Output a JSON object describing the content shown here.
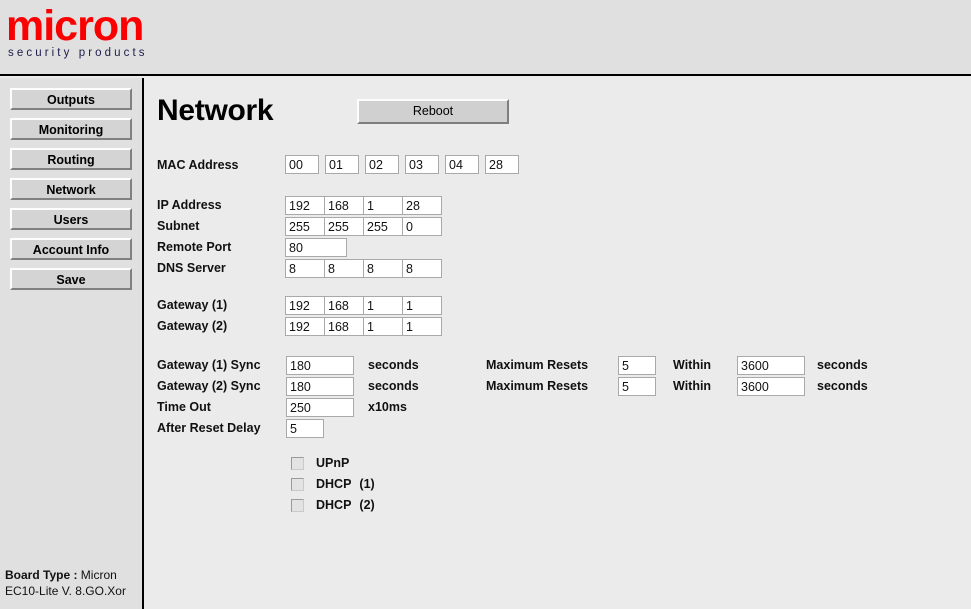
{
  "brand": {
    "name": "micron",
    "tagline": "security products",
    "accent_color": "#fb0000",
    "tagline_color": "#1c1c4a"
  },
  "sidebar": {
    "items": [
      {
        "label": "Outputs"
      },
      {
        "label": "Monitoring"
      },
      {
        "label": "Routing"
      },
      {
        "label": "Network"
      },
      {
        "label": "Users"
      },
      {
        "label": "Account Info"
      },
      {
        "label": "Save"
      }
    ],
    "board": {
      "label": "Board Type :",
      "name": "Micron",
      "version": "EC10-Lite V. 8.GO.Xor"
    }
  },
  "main": {
    "title": "Network",
    "reboot_label": "Reboot",
    "mac": {
      "label": "MAC Address",
      "bytes": [
        "00",
        "01",
        "02",
        "03",
        "04",
        "28"
      ]
    },
    "ip": {
      "label": "IP Address",
      "octets": [
        "192",
        "168",
        "1",
        "28"
      ]
    },
    "subnet": {
      "label": "Subnet",
      "octets": [
        "255",
        "255",
        "255",
        "0"
      ]
    },
    "remote_port": {
      "label": "Remote Port",
      "value": "80"
    },
    "dns": {
      "label": "DNS Server",
      "octets": [
        "8",
        "8",
        "8",
        "8"
      ]
    },
    "gateway1": {
      "label": "Gateway (1)",
      "octets": [
        "192",
        "168",
        "1",
        "1"
      ]
    },
    "gateway2": {
      "label": "Gateway (2)",
      "octets": [
        "192",
        "168",
        "1",
        "1"
      ]
    },
    "gateway1_sync": {
      "label": "Gateway (1) Sync",
      "value": "180",
      "unit": "seconds"
    },
    "gateway2_sync": {
      "label": "Gateway (2) Sync",
      "value": "180",
      "unit": "seconds"
    },
    "timeout": {
      "label": "Time Out",
      "value": "250",
      "unit": "x10ms"
    },
    "after_reset_delay": {
      "label": "After Reset Delay",
      "value": "5"
    },
    "max_resets_1": {
      "label": "Maximum Resets",
      "value": "5",
      "within_label": "Within",
      "within_value": "3600",
      "unit": "seconds"
    },
    "max_resets_2": {
      "label": "Maximum Resets",
      "value": "5",
      "within_label": "Within",
      "within_value": "3600",
      "unit": "seconds"
    },
    "checkboxes": [
      {
        "label": "UPnP",
        "suffix": "",
        "checked": false
      },
      {
        "label": "DHCP",
        "suffix": "(1)",
        "checked": false
      },
      {
        "label": "DHCP",
        "suffix": "(2)",
        "checked": false
      }
    ]
  }
}
